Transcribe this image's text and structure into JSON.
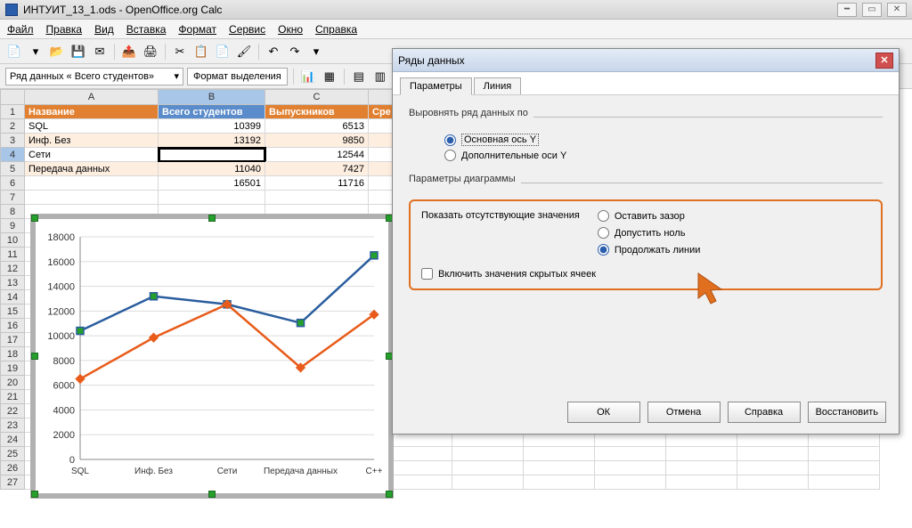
{
  "window": {
    "title": "ИНТУИТ_13_1.ods - OpenOffice.org Calc"
  },
  "menus": [
    "Файл",
    "Правка",
    "Вид",
    "Вставка",
    "Формат",
    "Сервис",
    "Окно",
    "Справка"
  ],
  "toolbar2": {
    "namebox": "Ряд данных « Всего студентов»",
    "fmt_selection": "Формат выделения"
  },
  "columns": [
    "A",
    "B",
    "C"
  ],
  "table": {
    "header": [
      "Название",
      "Всего студентов",
      "Выпускников",
      "Сре"
    ],
    "rows": [
      {
        "a": "SQL",
        "b": "10399",
        "c": "6513"
      },
      {
        "a": "Инф. Без",
        "b": "13192",
        "c": "9850"
      },
      {
        "a": "Сети",
        "b": "",
        "c": "12544"
      },
      {
        "a": "Передача данных",
        "b": "11040",
        "c": "7427"
      },
      {
        "a": "",
        "b": "16501",
        "c": "11716"
      }
    ]
  },
  "row_numbers": [
    1,
    2,
    3,
    4,
    5,
    6,
    7,
    8,
    9,
    10,
    11,
    12,
    13,
    14,
    15,
    16,
    17,
    18,
    19,
    20,
    21,
    22,
    23,
    24,
    25,
    26,
    27
  ],
  "chart_data": {
    "type": "line",
    "categories": [
      "SQL",
      "Инф. Без",
      "Сети",
      "Передача данных",
      "C++"
    ],
    "series": [
      {
        "name": "Всего студентов",
        "values": [
          10399,
          13192,
          12544,
          11040,
          16501
        ],
        "color": "#2a5d9e"
      },
      {
        "name": "Выпускников",
        "values": [
          6513,
          9850,
          12544,
          7427,
          11716
        ],
        "color": "#e85b1a"
      }
    ],
    "ylim": [
      0,
      18000
    ],
    "ystep": 2000
  },
  "dialog": {
    "title": "Ряды данных",
    "tabs": {
      "params": "Параметры",
      "line": "Линия"
    },
    "align_section": "Выровнять ряд данных по",
    "align_primary": "Основная ось Y",
    "align_secondary": "Дополнительные оси Y",
    "diagram_section": "Параметры диаграммы",
    "missing_label": "Показать отсутствующие значения",
    "opt_gap": "Оставить зазор",
    "opt_zero": "Допустить ноль",
    "opt_continue": "Продолжать линии",
    "include_hidden": "Включить значения скрытых ячеек",
    "buttons": {
      "ok": "ОК",
      "cancel": "Отмена",
      "help": "Справка",
      "reset": "Восстановить"
    }
  }
}
